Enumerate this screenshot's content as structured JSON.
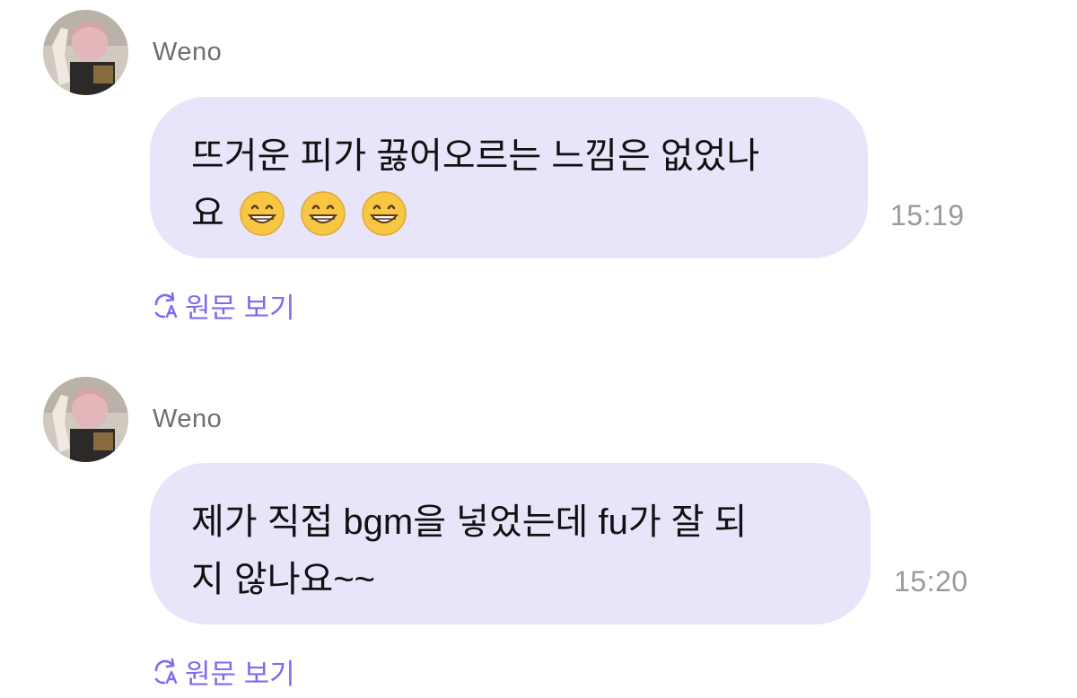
{
  "messages": [
    {
      "sender": "Weno",
      "lines": [
        "뜨거운 피가 끓어오르는 느낌은 없었나",
        "요"
      ],
      "emoji": [
        "grinning-face-emoji",
        "grinning-face-emoji",
        "grinning-face-emoji"
      ],
      "time": "15:19",
      "translate_label": "원문 보기"
    },
    {
      "sender": "Weno",
      "lines": [
        "제가 직접 bgm을 넣었는데 fu가 잘 되",
        "지 않나요~~"
      ],
      "time": "15:20",
      "translate_label": "원문 보기"
    }
  ],
  "colors": {
    "bubble": "#e8e4fa",
    "accent": "#7c6cf0",
    "timestamp": "#9a9a9a",
    "sender": "#6f6f6f"
  }
}
